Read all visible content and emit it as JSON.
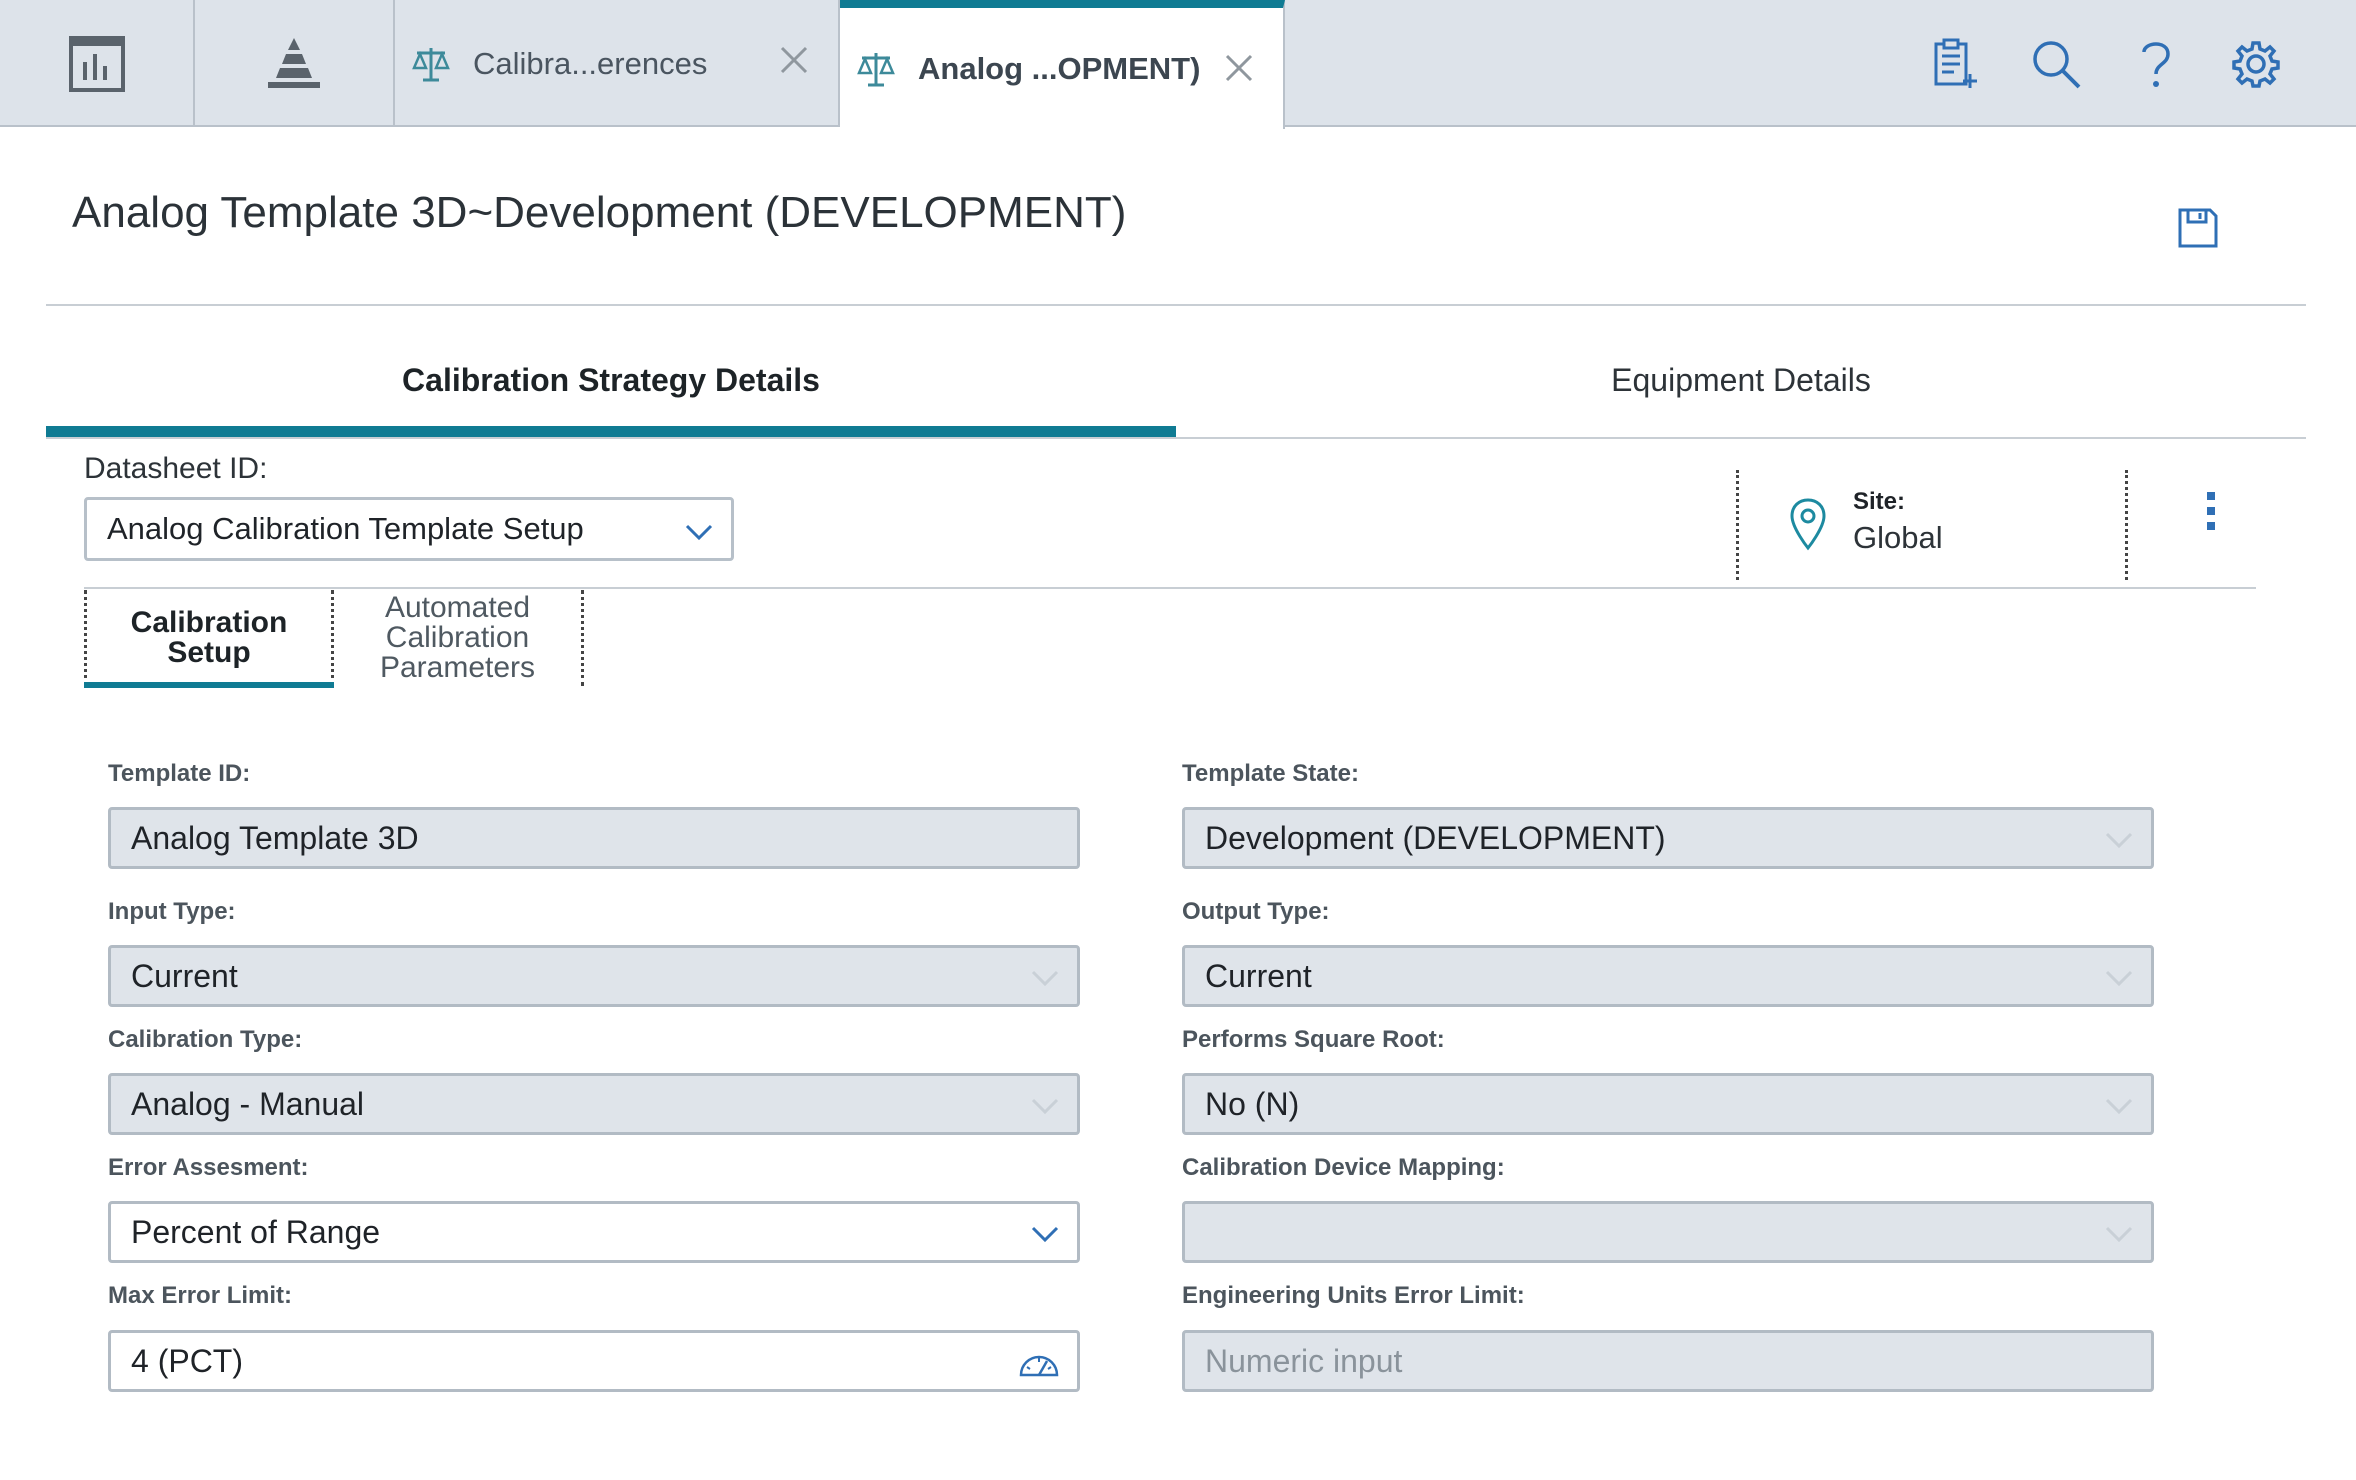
{
  "topbar": {
    "tabs": [
      {
        "label": "Calibra...erences",
        "icon": "scale-icon"
      },
      {
        "label": "Analog ...OPMENT)",
        "icon": "scale-icon"
      }
    ]
  },
  "header": {
    "title": "Analog Template 3D~Development (DEVELOPMENT)"
  },
  "main_tabs": [
    {
      "label": "Calibration Strategy Details",
      "active": true
    },
    {
      "label": "Equipment Details",
      "active": false
    }
  ],
  "datasheet": {
    "label": "Datasheet ID:",
    "value": "Analog Calibration Template Setup"
  },
  "site": {
    "label": "Site:",
    "value": "Global"
  },
  "sub_tabs": [
    {
      "label": "Calibration Setup",
      "active": true
    },
    {
      "label": "Automated Calibration Parameters",
      "active": false
    }
  ],
  "form": {
    "template_id": {
      "label": "Template ID:",
      "value": "Analog Template 3D"
    },
    "template_state": {
      "label": "Template State:",
      "value": "Development (DEVELOPMENT)"
    },
    "input_type": {
      "label": "Input Type:",
      "value": "Current"
    },
    "output_type": {
      "label": "Output Type:",
      "value": "Current"
    },
    "calibration_type": {
      "label": "Calibration Type:",
      "value": "Analog - Manual"
    },
    "performs_square_root": {
      "label": "Performs Square Root:",
      "value": "No (N)"
    },
    "error_assessment": {
      "label": "Error Assesment:",
      "value": "Percent of Range"
    },
    "calibration_device_mapping": {
      "label": "Calibration Device Mapping:",
      "value": ""
    },
    "max_error_limit": {
      "label": "Max Error Limit:",
      "value": "4 (PCT)"
    },
    "eng_units_error_limit": {
      "label": "Engineering Units Error Limit:",
      "value": "",
      "placeholder": "Numeric input"
    }
  },
  "colors": {
    "accent": "#0f7b93",
    "icon_blue": "#2f6fb5",
    "topbar_bg": "#dde3ea",
    "readonly_bg": "#dfe4ea"
  }
}
